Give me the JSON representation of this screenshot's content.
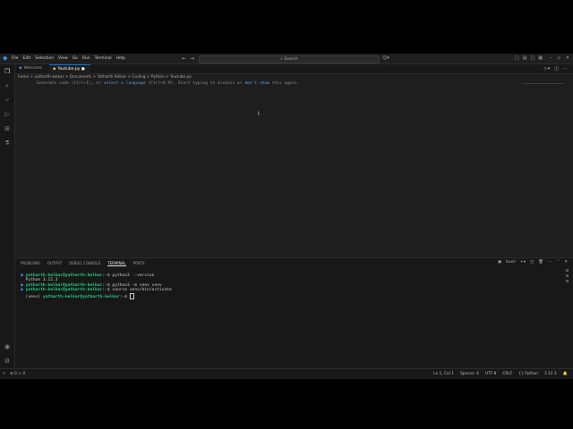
{
  "menu": [
    "File",
    "Edit",
    "Selection",
    "View",
    "Go",
    "Run",
    "Terminal",
    "Help"
  ],
  "search": {
    "placeholder": "Search"
  },
  "tabs": [
    {
      "label": "Welcome",
      "active": false
    },
    {
      "label": "Youtube.py",
      "active": true
    }
  ],
  "breadcrumb": "home > yatharth-kelkar > Documents > Yatharth Kelkar > Coding > Python > Youtube.py",
  "editor": {
    "hint_prefix": "Generate code (Ctrl+I), or ",
    "hint_link1": "select a language",
    "hint_mid": " (Ctrl+K M). Start typing to dismiss or ",
    "hint_link2": "don't show",
    "hint_suffix": " this again."
  },
  "panel": {
    "tabs": [
      "PROBLEMS",
      "OUTPUT",
      "DEBUG CONSOLE",
      "TERMINAL",
      "PORTS"
    ],
    "active_tab": "TERMINAL",
    "terminal_name": "bash"
  },
  "terminal": {
    "user": "yatharth-kelkar@yatharth-kelkar",
    "path": "~",
    "lines": [
      {
        "cmd": "python3 --version"
      },
      {
        "output": "Python 3.12.3"
      },
      {
        "cmd": "python3 -m venv venv"
      },
      {
        "cmd": "source venv/bin/activate"
      }
    ],
    "venv_prefix": "(venv)"
  },
  "statusbar": {
    "left": [
      "⊗ 0 ⚠ 0"
    ],
    "position": "Ln 1, Col 1",
    "spaces": "Spaces: 4",
    "encoding": "UTF-8",
    "eol": "CRLF",
    "language": "{} Python",
    "version": "3.12.3"
  },
  "colors": {
    "accent": "#0078d4",
    "prompt_user": "#23d18b",
    "prompt_path": "#3b8eea"
  }
}
